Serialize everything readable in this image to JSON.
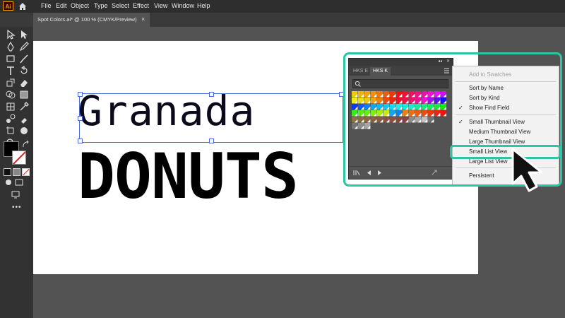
{
  "app": {
    "logo_text": "Ai"
  },
  "menubar": [
    "File",
    "Edit",
    "Object",
    "Type",
    "Select",
    "Effect",
    "View",
    "Window",
    "Help"
  ],
  "document_tab": {
    "title": "Spot Colors.ai* @ 100 % (CMYK/Preview)",
    "close": "×"
  },
  "artboard": {
    "line1": "Granada",
    "line2": "DONUTS"
  },
  "swatches_panel": {
    "tabs": [
      "HKS E",
      "HKS K"
    ],
    "active_tab": "HKS K",
    "collapse_glyph": "◂◂",
    "close_glyph": "✕"
  },
  "flyout_menu": {
    "items": [
      {
        "label": "Add to Swatches",
        "disabled": true
      },
      {
        "label": "Sort by Name"
      },
      {
        "label": "Sort by Kind"
      },
      {
        "label": "Show Find Field",
        "checked": true
      },
      {
        "label": "Small Thumbnail View",
        "checked": true
      },
      {
        "label": "Medium Thumbnail View"
      },
      {
        "label": "Large Thumbnail View"
      },
      {
        "label": "Small List View",
        "highlighted": true
      },
      {
        "label": "Large List View"
      },
      {
        "label": "Persistent"
      }
    ],
    "check_glyph": "✓"
  },
  "colors": {
    "accent_highlight": "#2ec4a6",
    "app_brand": "#ff9a00"
  }
}
